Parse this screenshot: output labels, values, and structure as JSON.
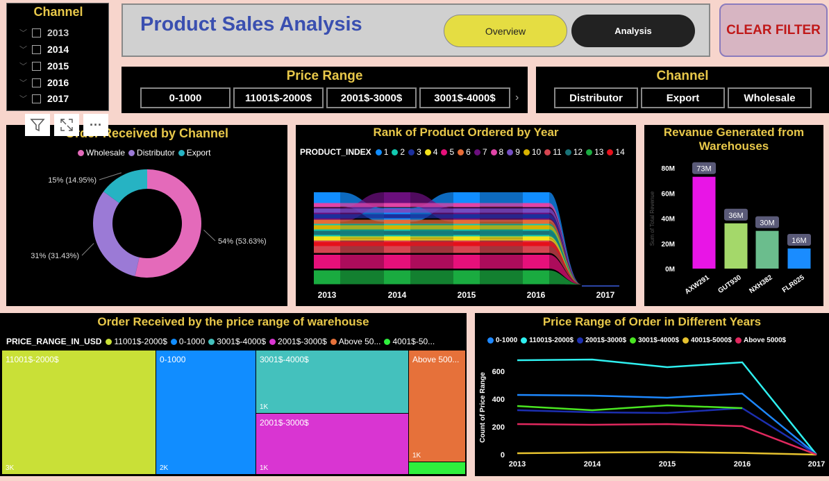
{
  "year_slicer": {
    "title": "Channel",
    "items": [
      {
        "label": "2013",
        "color": "#cccccc"
      },
      {
        "label": "2014",
        "color": "#ffffff"
      },
      {
        "label": "2015",
        "color": "#ffffff"
      },
      {
        "label": "2016",
        "color": "#ffffff"
      },
      {
        "label": "2017",
        "color": "#ffffff"
      }
    ]
  },
  "header": {
    "title": "Product Sales Analysis",
    "overview_label": "Overview",
    "analysis_label": "Analysis"
  },
  "clear_filter_label": "CLEAR FILTER",
  "price_slicer": {
    "title": "Price Range",
    "items": [
      "0-1000",
      "11001$-2000$",
      "2001$-3000$",
      "3001$-4000$"
    ],
    "more_glyph": "›"
  },
  "channel_slicer": {
    "title": "Channel",
    "items": [
      "Distributor",
      "Export",
      "Wholesale"
    ]
  },
  "toolbar": {
    "filter_icon": "filter-icon",
    "focus_icon": "focus-mode-icon",
    "more_glyph": "···"
  },
  "colors": {
    "panel": "#000000",
    "title_gold": "#e8c84a",
    "page_bg": "#f7d5cc"
  },
  "donut": {
    "title": "Order Received by Channel",
    "legend": [
      {
        "name": "Wholesale",
        "color": "#e46aba"
      },
      {
        "name": "Distributor",
        "color": "#9b7ad6"
      },
      {
        "name": "Export",
        "color": "#26b3c3"
      }
    ],
    "chart_data": {
      "type": "pie",
      "categories": [
        "Wholesale",
        "Distributor",
        "Export"
      ],
      "values": [
        53.63,
        31.43,
        14.95
      ],
      "labels": [
        "54% (53.63%)",
        "31% (31.43%)",
        "15% (14.95%)"
      ]
    }
  },
  "ribbon": {
    "title": "Rank of Product Ordered by Year",
    "legend_title": "PRODUCT_INDEX",
    "legend": [
      {
        "name": "1",
        "color": "#118dff"
      },
      {
        "name": "2",
        "color": "#12c9b0"
      },
      {
        "name": "3",
        "color": "#1b2f9c"
      },
      {
        "name": "4",
        "color": "#f5e31b"
      },
      {
        "name": "5",
        "color": "#e6107a"
      },
      {
        "name": "6",
        "color": "#e66c37"
      },
      {
        "name": "7",
        "color": "#6b0f7d"
      },
      {
        "name": "8",
        "color": "#e044a7"
      },
      {
        "name": "9",
        "color": "#744ec2"
      },
      {
        "name": "10",
        "color": "#d9b300"
      },
      {
        "name": "11",
        "color": "#d64550"
      },
      {
        "name": "12",
        "color": "#197278"
      },
      {
        "name": "13",
        "color": "#1aab40"
      },
      {
        "name": "14",
        "color": "#e6101b"
      }
    ],
    "chart_data": {
      "type": "area",
      "x": [
        "2013",
        "2014",
        "2015",
        "2016",
        "2017"
      ],
      "series": [
        {
          "name": "1",
          "values": [
            1,
            2,
            1,
            1,
            0
          ]
        },
        {
          "name": "7",
          "values": [
            2,
            1,
            2,
            2,
            0
          ]
        },
        {
          "name": "2",
          "values": [
            3,
            3,
            3,
            3,
            0
          ]
        },
        {
          "name": "11",
          "values": [
            4,
            4,
            4,
            4,
            0
          ]
        },
        {
          "name": "5",
          "values": [
            5,
            5,
            5,
            5,
            0
          ]
        },
        {
          "name": "13",
          "values": [
            6,
            6,
            6,
            6,
            0
          ]
        },
        {
          "name": "8",
          "values": [
            7,
            7,
            7,
            7,
            0
          ]
        },
        {
          "name": "9",
          "values": [
            8,
            8,
            8,
            8,
            0
          ]
        },
        {
          "name": "3",
          "values": [
            9,
            9,
            9,
            9,
            0
          ]
        },
        {
          "name": "6",
          "values": [
            10,
            10,
            10,
            10,
            0
          ]
        },
        {
          "name": "10",
          "values": [
            11,
            11,
            11,
            11,
            0
          ]
        },
        {
          "name": "12",
          "values": [
            12,
            12,
            12,
            12,
            0
          ]
        },
        {
          "name": "4",
          "values": [
            13,
            13,
            13,
            13,
            0
          ]
        },
        {
          "name": "14",
          "values": [
            14,
            14,
            14,
            14,
            0
          ]
        }
      ]
    }
  },
  "revenue": {
    "title_line1": "Revanue Generated from",
    "title_line2": "Warehouses",
    "ylabel": "Sum of Total Revenue",
    "yticks": [
      "0M",
      "20M",
      "40M",
      "60M",
      "80M"
    ],
    "chart_data": {
      "type": "bar",
      "categories": [
        "AXW291",
        "GUT930",
        "NXH382",
        "FLR025"
      ],
      "values": [
        73,
        36,
        30,
        16
      ],
      "data_labels": [
        "73M",
        "36M",
        "30M",
        "16M"
      ],
      "colors": [
        "#e815e6",
        "#a4d86a",
        "#6bbd8d",
        "#1a8cff"
      ],
      "ylim": [
        0,
        80
      ]
    }
  },
  "treemap": {
    "title": "Order Received by the price range of warehouse",
    "legend_title": "PRICE_RANGE_IN_USD",
    "legend": [
      {
        "name": "11001$-2000$",
        "color": "#c9e037"
      },
      {
        "name": "0-1000",
        "color": "#118dff"
      },
      {
        "name": "3001$-4000$",
        "color": "#44c1bd"
      },
      {
        "name": "2001$-3000$",
        "color": "#d935d2"
      },
      {
        "name": "Above 50...",
        "color": "#e6713a"
      },
      {
        "name": "4001$-50...",
        "color": "#2ff03d"
      }
    ],
    "chart_data": {
      "type": "heatmap",
      "categories": [
        "11001$-2000$",
        "0-1000",
        "3001$-4000$",
        "2001$-3000$",
        "Above 500...",
        "4001$-5000$"
      ],
      "value_labels": [
        "3K",
        "2K",
        "1K",
        "1K",
        "1K",
        ""
      ]
    }
  },
  "linechart": {
    "title": "Price Range of Order in Different Years",
    "ylabel": "Count of Price Range",
    "legend": [
      {
        "name": "0-1000",
        "color": "#1e88ff"
      },
      {
        "name": "11001$-2000$",
        "color": "#2ff0f0"
      },
      {
        "name": "2001$-3000$",
        "color": "#1c2fb0"
      },
      {
        "name": "3001$-4000$",
        "color": "#4ae622"
      },
      {
        "name": "4001$-5000$",
        "color": "#e6c22f"
      },
      {
        "name": "Above 5000$",
        "color": "#e0285e"
      }
    ],
    "yticks": [
      "0",
      "200",
      "400",
      "600"
    ],
    "chart_data": {
      "type": "line",
      "x": [
        "2013",
        "2014",
        "2015",
        "2016",
        "2017"
      ],
      "ylim": [
        0,
        700
      ],
      "series": [
        {
          "name": "0-1000",
          "values": [
            430,
            425,
            410,
            440,
            0
          ]
        },
        {
          "name": "11001$-2000$",
          "values": [
            680,
            685,
            630,
            665,
            0
          ]
        },
        {
          "name": "2001$-3000$",
          "values": [
            320,
            305,
            300,
            335,
            0
          ]
        },
        {
          "name": "3001$-4000$",
          "values": [
            350,
            320,
            355,
            335,
            null
          ]
        },
        {
          "name": "4001$-5000$",
          "values": [
            10,
            15,
            18,
            12,
            0
          ]
        },
        {
          "name": "Above 5000$",
          "values": [
            220,
            215,
            220,
            205,
            0
          ]
        }
      ]
    }
  }
}
